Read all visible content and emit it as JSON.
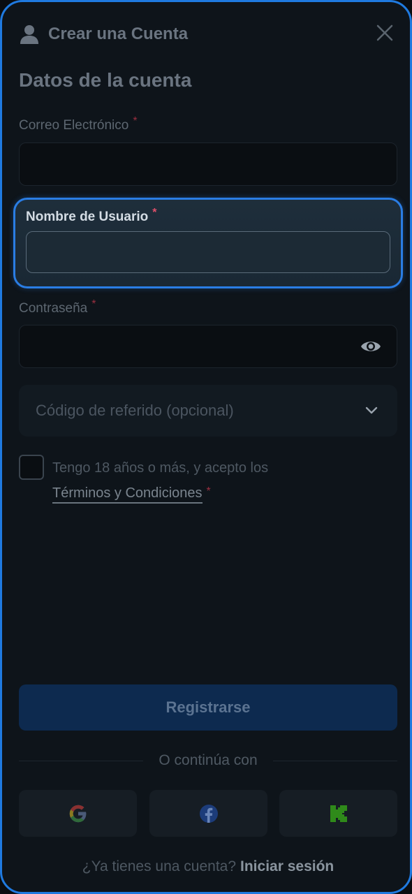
{
  "header": {
    "title": "Crear una Cuenta",
    "user_icon": "user-icon",
    "close_icon": "close-icon"
  },
  "section": {
    "title": "Datos de la cuenta"
  },
  "form": {
    "email": {
      "label": "Correo Electrónico",
      "required": "*",
      "value": ""
    },
    "username": {
      "label": "Nombre de Usuario",
      "required": "*",
      "value": ""
    },
    "password": {
      "label": "Contraseña",
      "required": "*",
      "value": "",
      "toggle_icon": "eye-icon"
    },
    "referral": {
      "placeholder": "Código de referido (opcional)",
      "icon": "chevron-down-icon"
    },
    "terms": {
      "text": "Tengo 18 años o más, y acepto los",
      "link": "Términos y Condiciones",
      "required": "*",
      "checked": false
    }
  },
  "actions": {
    "register_label": "Registrarse",
    "divider_text": "O continúa con"
  },
  "social": [
    {
      "name": "Google",
      "icon": "google-icon"
    },
    {
      "name": "Facebook",
      "icon": "facebook-icon"
    },
    {
      "name": "Kick",
      "icon": "kick-icon"
    }
  ],
  "footer": {
    "question": "¿Ya tienes una cuenta?",
    "login_label": "Iniciar sesión"
  },
  "colors": {
    "accent": "#1f7ae0",
    "background": "#0e141a",
    "button": "#0d2a4f",
    "required": "#e0506a"
  }
}
